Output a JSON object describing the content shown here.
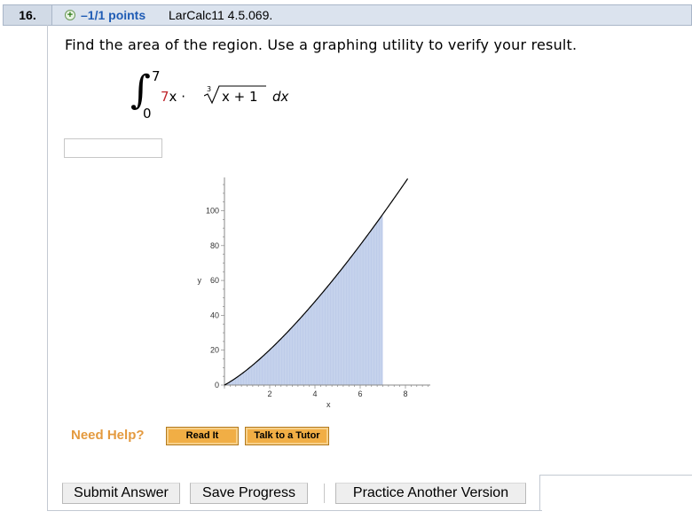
{
  "header": {
    "question_number": "16.",
    "points": "–1/1 points",
    "source": "LarCalc11 4.5.069."
  },
  "question": {
    "prompt": "Find the area of the region. Use a graphing utility to verify your result.",
    "integral": {
      "upper": "7",
      "lower": "0",
      "coefficient": "7",
      "variable_times": "x ·",
      "root_index": "3",
      "radicand": "x + 1",
      "differential": "dx"
    },
    "answer_value": ""
  },
  "chart_data": {
    "type": "area",
    "function": "7x·cbrt(x+1)",
    "x": [
      0,
      0.5,
      1,
      1.5,
      2,
      2.5,
      3,
      3.5,
      4,
      4.5,
      5,
      5.5,
      6,
      6.5,
      7,
      7.5,
      8
    ],
    "y": [
      0,
      4.01,
      8.82,
      14.25,
      20.19,
      26.58,
      33.34,
      40.45,
      47.88,
      55.6,
      63.58,
      71.8,
      80.26,
      88.94,
      97.82,
      106.9,
      116.17
    ],
    "shaded_range": [
      0,
      7
    ],
    "xlim": [
      0,
      8.3
    ],
    "ylim": [
      0,
      118
    ],
    "x_ticks": [
      "2",
      "4",
      "6",
      "8"
    ],
    "y_ticks": [
      "0",
      "20",
      "40",
      "60",
      "80",
      "100"
    ],
    "xlabel": "x",
    "ylabel": "y",
    "fill_color": "#c5d2ec",
    "curve_color": "#000000"
  },
  "help": {
    "label": "Need Help?",
    "read_it": "Read It",
    "tutor": "Talk to a Tutor"
  },
  "actions": {
    "submit": "Submit Answer",
    "save": "Save Progress",
    "practice": "Practice Another Version"
  },
  "colors": {
    "points_blue": "#1f5cb5",
    "help_orange": "#e49a3f",
    "button_orange": "#f1ae45"
  }
}
